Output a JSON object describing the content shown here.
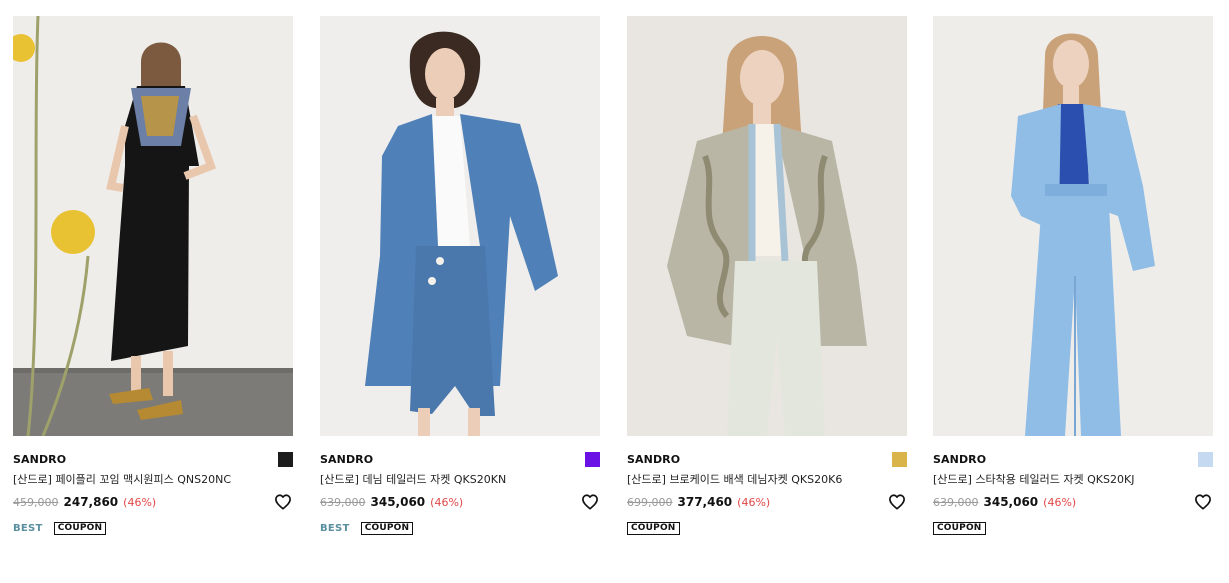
{
  "products": [
    {
      "brand": "SANDRO",
      "name": "[산드로] 페이플리 꼬임 맥시원피스 QNS20NC",
      "original_price": "459,000",
      "sale_price": "247,860",
      "discount": "(46%)",
      "swatch_color": "#1c1c1c",
      "badges": {
        "best": "BEST",
        "coupon": "COUPON"
      },
      "image_colors": {
        "bg": "#efedea",
        "floor": "#7d7b78",
        "garment": "#151515",
        "accent": "#e8c233"
      }
    },
    {
      "brand": "SANDRO",
      "name": "[산드로] 데님 테일러드 자켓 QKS20KN",
      "original_price": "639,000",
      "sale_price": "345,060",
      "discount": "(46%)",
      "swatch_color": "#6a12e6",
      "badges": {
        "best": "BEST",
        "coupon": "COUPON"
      },
      "image_colors": {
        "bg": "#efeeec",
        "garment": "#4f80b8",
        "shirt": "#fafafa",
        "hair": "#3a2a22"
      }
    },
    {
      "brand": "SANDRO",
      "name": "[산드로] 브로케이드 배색 데님자켓 QKS20K6",
      "original_price": "699,000",
      "sale_price": "377,460",
      "discount": "(46%)",
      "swatch_color": "#d9b44a",
      "badges": {
        "coupon": "COUPON"
      },
      "image_colors": {
        "bg": "#e9e6e1",
        "garment": "#b9b6a6",
        "pants": "#e3e6dd",
        "hair": "#c9a27a"
      }
    },
    {
      "brand": "SANDRO",
      "name": "[산드로] 스타착용 테일러드 자켓 QKS20KJ",
      "original_price": "639,000",
      "sale_price": "345,060",
      "discount": "(46%)",
      "swatch_color": "#c5d9f1",
      "badges": {
        "coupon": "COUPON"
      },
      "image_colors": {
        "bg": "#efedea",
        "garment": "#8fbde6",
        "shirt": "#2b4fae",
        "hair": "#c9a27a"
      }
    }
  ]
}
